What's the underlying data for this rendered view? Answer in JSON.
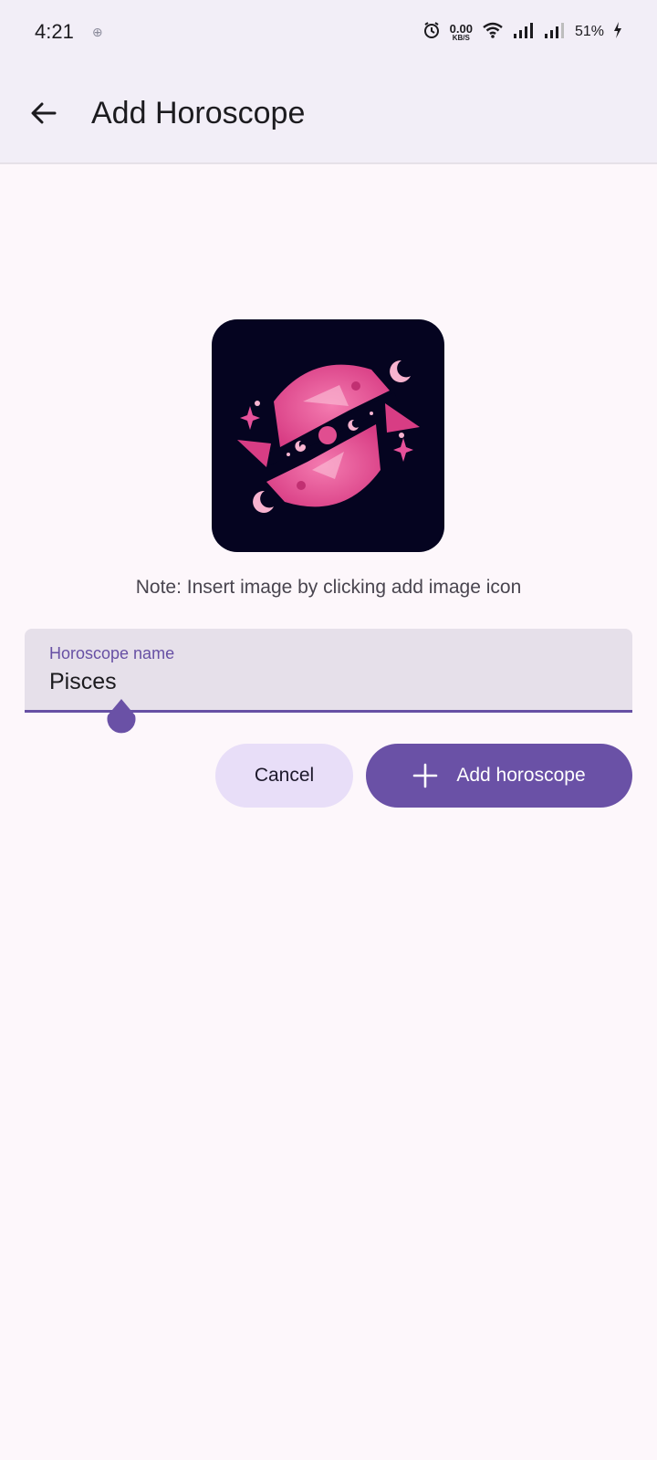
{
  "status_bar": {
    "time": "4:21",
    "speed_value": "0.00",
    "speed_unit": "KB/S",
    "battery": "51%"
  },
  "app_bar": {
    "title": "Add Horoscope",
    "back_icon": "arrow-back-icon"
  },
  "image": {
    "description_icon": "pisces-zodiac-image"
  },
  "note": "Note: Insert image by clicking add image icon",
  "form": {
    "label": "Horoscope name",
    "value": "Pisces"
  },
  "actions": {
    "cancel_label": "Cancel",
    "add_label": "Add horoscope",
    "add_icon": "plus-icon"
  },
  "colors": {
    "primary": "#6a51a6",
    "secondary_container": "#e8def8",
    "surface": "#fdf7fb",
    "app_bar": "#f2eef7",
    "field_bg": "#e6e0ea"
  }
}
